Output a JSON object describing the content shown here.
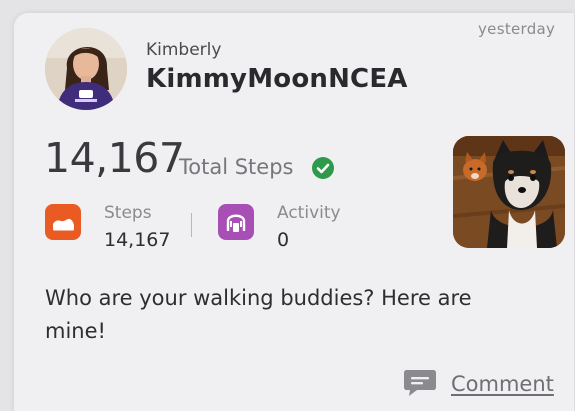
{
  "post": {
    "timestamp": "yesterday",
    "user": {
      "display_name": "Kimberly",
      "username": "KimmyMoonNCEA"
    },
    "total_steps": {
      "value": "14,167",
      "label": "Total Steps",
      "verified_icon": "check-circle-icon"
    },
    "stats": [
      {
        "title": "Steps",
        "value": "14,167",
        "icon": "shoe-icon",
        "color": "#ea5a23"
      },
      {
        "title": "Activity",
        "value": "0",
        "icon": "activity-icon",
        "color": "#a84fb6"
      }
    ],
    "message": "Who are your walking buddies? Here are mine!",
    "comment_label": "Comment",
    "comment_icon": "speech-bubble-icon"
  },
  "colors": {
    "card_bg": "#f0f0f2",
    "verified_green": "#2f9a4b",
    "steps_orange": "#ea5a23",
    "activity_purple": "#a84fb6"
  }
}
